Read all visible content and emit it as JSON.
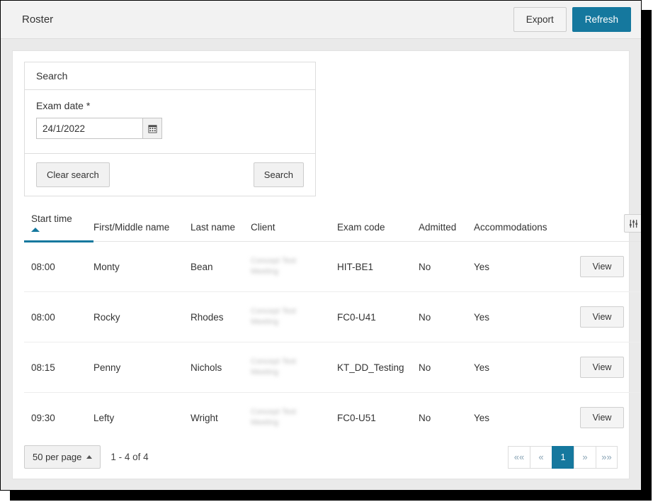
{
  "window": {
    "title": "Roster",
    "accent_color": "#15789e",
    "header_bg": "#f2f2f2",
    "body_bg": "#eaeaea"
  },
  "toolbar": {
    "export_label": "Export",
    "refresh_label": "Refresh"
  },
  "search": {
    "panel_title": "Search",
    "date_label": "Exam date *",
    "date_value": "24/1/2022",
    "date_placeholder": "",
    "calendar_icon": "calendar-icon",
    "clear_label": "Clear search",
    "submit_label": "Search"
  },
  "table": {
    "columns": [
      "Start time",
      "First/Middle name",
      "Last name",
      "Client",
      "Exam code",
      "Admitted",
      "Accommodations"
    ],
    "sorted_column": "Start time",
    "sort_direction": "asc",
    "settings_icon": "sliders-icon",
    "action_label": "View",
    "client_redacted_line1": "Concept Test",
    "client_redacted_line2": "Meeting",
    "rows": [
      {
        "start_time": "08:00",
        "first_name": "Monty",
        "last_name": "Bean",
        "exam_code": "HIT-BE1",
        "admitted": "No",
        "accommodations": "Yes"
      },
      {
        "start_time": "08:00",
        "first_name": "Rocky",
        "last_name": "Rhodes",
        "exam_code": "FC0-U41",
        "admitted": "No",
        "accommodations": "Yes"
      },
      {
        "start_time": "08:15",
        "first_name": "Penny",
        "last_name": "Nichols",
        "exam_code": "KT_DD_Testing",
        "admitted": "No",
        "accommodations": "Yes"
      },
      {
        "start_time": "09:30",
        "first_name": "Lefty",
        "last_name": "Wright",
        "exam_code": "FC0-U51",
        "admitted": "No",
        "accommodations": "Yes"
      }
    ]
  },
  "footer": {
    "per_page_label": "50 per page",
    "range_text": "1 - 4 of 4",
    "pager": {
      "first": "««",
      "prev": "«",
      "current_page": "1",
      "next": "»",
      "last": "»»"
    }
  }
}
